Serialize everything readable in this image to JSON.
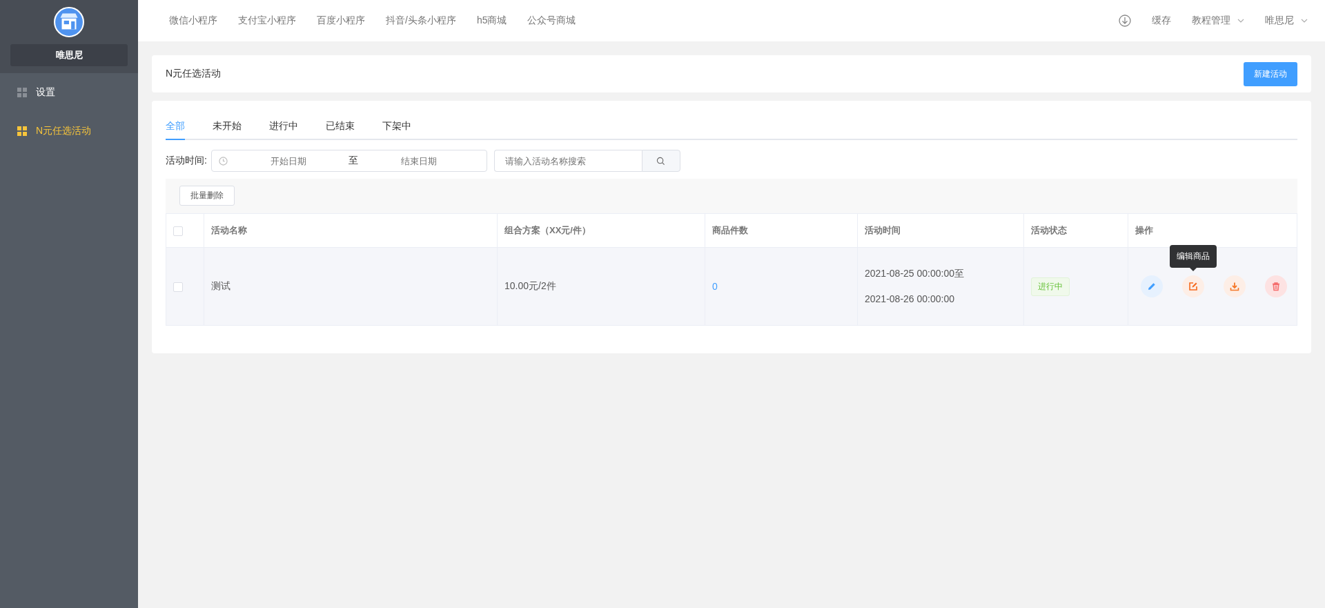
{
  "sidebar": {
    "brand": "唯思尼",
    "items": [
      {
        "label": "设置",
        "selected": false
      },
      {
        "label": "N元任选活动",
        "selected": true
      }
    ]
  },
  "topnav": {
    "links": [
      "微信小程序",
      "支付宝小程序",
      "百度小程序",
      "抖音/头条小程序",
      "h5商城",
      "公众号商城"
    ],
    "cache": "缓存",
    "menus": [
      "教程管理",
      "唯思尼"
    ]
  },
  "header": {
    "title": "N元任选活动",
    "new_button": "新建活动"
  },
  "tabs": [
    {
      "label": "全部",
      "selected": true
    },
    {
      "label": "未开始",
      "selected": false
    },
    {
      "label": "进行中",
      "selected": false
    },
    {
      "label": "已结束",
      "selected": false
    },
    {
      "label": "下架中",
      "selected": false
    }
  ],
  "filter": {
    "label": "活动时间:",
    "start_placeholder": "开始日期",
    "separator": "至",
    "end_placeholder": "结束日期",
    "search_placeholder": "请输入活动名称搜索"
  },
  "batch_delete": "批量删除",
  "table": {
    "all_checked": false,
    "columns": [
      "活动名称",
      "组合方案（XX元/件）",
      "商品件数",
      "活动时间",
      "活动状态",
      "操作"
    ],
    "rows": [
      {
        "checked": false,
        "name": "测试",
        "plan": "10.00元/2件",
        "count": "0",
        "time_start": "2021-08-25 00:00:00至",
        "time_end": "2021-08-26 00:00:00",
        "status": {
          "label": "进行中",
          "kind": "active"
        },
        "actions": [
          {
            "kind": "edit"
          },
          {
            "kind": "edit-goods",
            "tooltip": "编辑商品"
          },
          {
            "kind": "download"
          },
          {
            "kind": "delete"
          }
        ]
      }
    ]
  }
}
